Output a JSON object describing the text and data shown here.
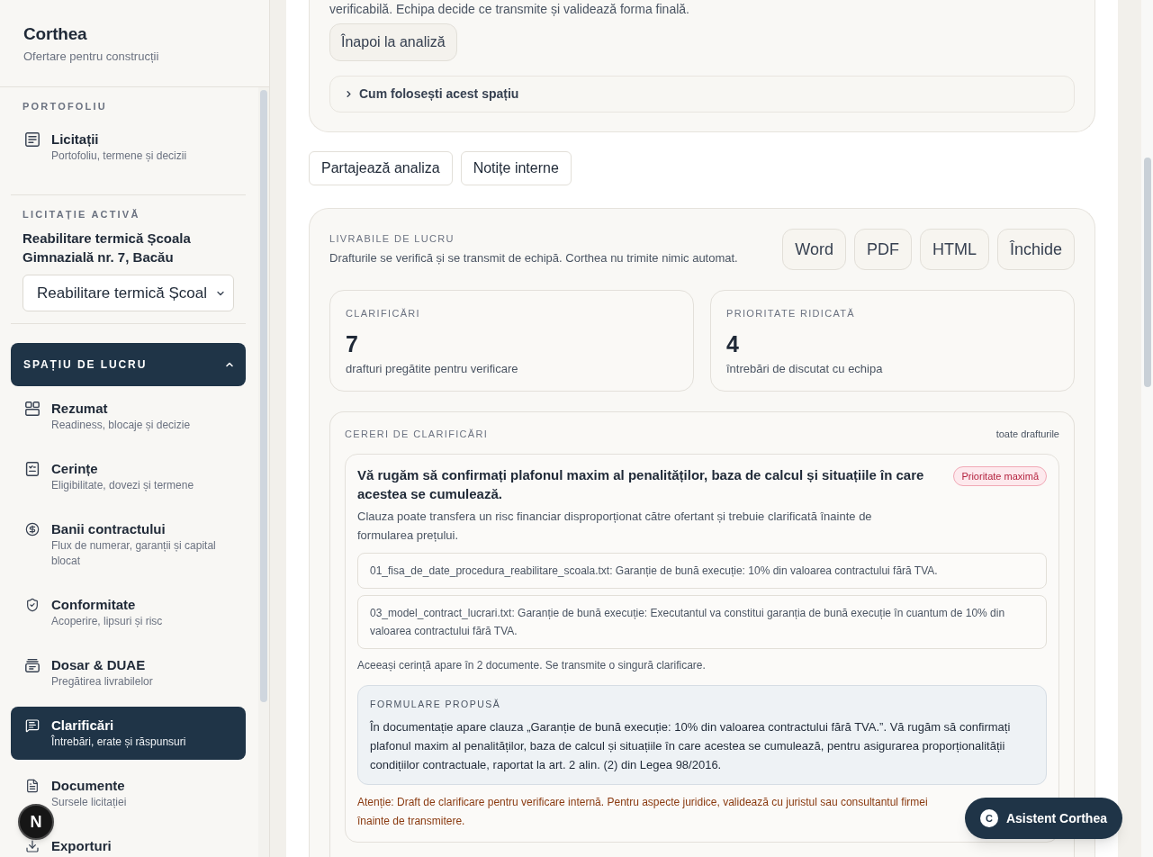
{
  "sidebar": {
    "brand": "Corthea",
    "tagline": "Ofertare pentru construcții",
    "portfolio": {
      "heading": "PORTOFOLIU",
      "items": [
        {
          "label": "Licitații",
          "description": "Portofoliu, termene și decizii",
          "selected": false
        }
      ]
    },
    "active_tender": {
      "heading": "LICITAȚIE ACTIVĂ",
      "title": "Reabilitare termică Școala Gimnazială nr. 7, Bacău",
      "select_value": "Reabilitare termică Școal"
    },
    "workspace": {
      "heading": "SPAȚIU DE LUCRU",
      "expanded": true,
      "items": [
        {
          "label": "Rezumat",
          "description": "Readiness, blocaje și decizie",
          "selected": false
        },
        {
          "label": "Cerințe",
          "description": "Eligibilitate, dovezi și termene",
          "selected": false
        },
        {
          "label": "Banii contractului",
          "description": "Flux de numerar, garanții și capital blocat",
          "selected": false
        },
        {
          "label": "Conformitate",
          "description": "Acoperire, lipsuri și risc",
          "selected": false
        },
        {
          "label": "Dosar & DUAE",
          "description": "Pregătirea livrabilelor",
          "selected": false
        },
        {
          "label": "Clarificări",
          "description": "Întrebări, erate și răspunsuri",
          "selected": true
        },
        {
          "label": "Documente",
          "description": "Sursele licitației",
          "selected": false
        },
        {
          "label": "Exporturi",
          "selected": false
        }
      ]
    }
  },
  "dev_badge": {
    "label": "N"
  },
  "main": {
    "intro": {
      "text": "verificabilă. Echipa decide ce transmite și validează forma finală.",
      "back_button": "Înapoi la analiză",
      "help": {
        "label": "Cum folosești acest spațiu",
        "expanded": false
      }
    },
    "actions": [
      "Partajează analiza",
      "Notițe interne"
    ],
    "deliverables": {
      "heading": "LIVRABILE DE LUCRU",
      "description": "Drafturile se verifică și se transmit de echipă. Corthea nu trimite nimic automat.",
      "buttons": [
        "Word",
        "PDF",
        "HTML",
        "Închide"
      ],
      "stats": [
        {
          "label": "CLARIFICĂRI",
          "value": "7",
          "caption": "drafturi pregătite pentru verificare"
        },
        {
          "label": "PRIORITATE RIDICATĂ",
          "value": "4",
          "caption": "întrebări de discutat cu echipa"
        }
      ],
      "requests": {
        "heading": "CERERI DE CLARIFICĂRI",
        "filter": "toate drafturile",
        "items": [
          {
            "question": "Vă rugăm să confirmați plafonul maxim al penalităților, baza de calcul și situațiile în care acestea se cumulează.",
            "priority": "Prioritate maximă",
            "rationale": "Clauza poate transfera un risc financiar disproporționat către ofertant și trebuie clarificată înainte de formularea prețului.",
            "sources": [
              "01_fisa_de_date_procedura_reabilitare_scoala.txt: Garanție de bună execuție: 10% din valoarea contractului fără TVA.",
              "03_model_contract_lucrari.txt: Garanție de bună execuție: Executantul va constitui garanția de bună execuție în cuantum de 10% din valoarea contractului fără TVA."
            ],
            "duplicate_note": "Aceeași cerință apare în 2 documente. Se transmite o singură clarificare.",
            "proposal": {
              "heading": "FORMULARE PROPUSĂ",
              "text": "În documentație apare clauza „Garanție de bună execuție: 10% din valoarea contractului fără TVA.”. Vă rugăm să confirmați plafonul maxim al penalităților, baza de calcul și situațiile în care acestea se cumulează, pentru asigurarea proporționalității condițiilor contractuale, raportat la art. 2 alin. (2) din Legea 98/2016."
            },
            "warning": "Atenție: Draft de clarificare pentru verificare internă. Pentru aspecte juridice, validează cu juristul sau consultantul firmei înainte de transmitere."
          }
        ]
      }
    }
  },
  "assistant_button": {
    "avatar": "C",
    "label": "Asistent Corthea"
  }
}
